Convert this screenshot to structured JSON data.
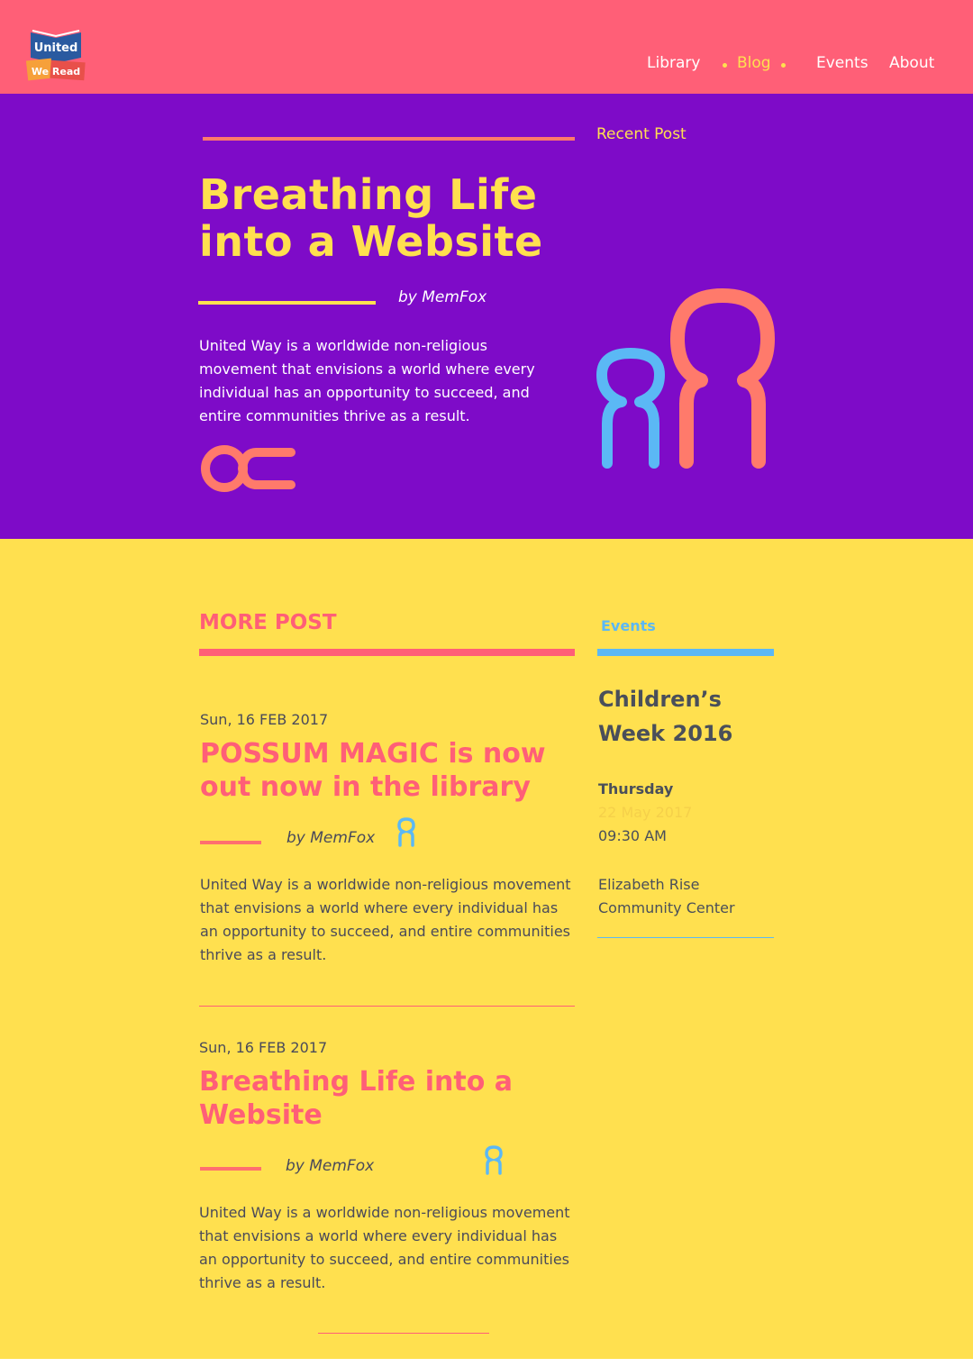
{
  "brand": {
    "logo_line1": "United",
    "logo_line2": "We Read"
  },
  "nav": {
    "items": [
      {
        "label": "Library"
      },
      {
        "label": "Blog"
      },
      {
        "label": "Events"
      },
      {
        "label": "About"
      }
    ],
    "active": "Blog"
  },
  "hero": {
    "title": "Breathing Life into a Website",
    "byline": "by MemFox",
    "text": "United Way is a worldwide non-religious movement that envisions a world where every individual has an opportunity to succeed, and entire communities thrive as a result.",
    "recent_label": "Recent Post"
  },
  "more": {
    "heading": "MORE POST",
    "posts": [
      {
        "date": "Sun, 16 FEB 2017",
        "title": "POSSUM MAGIC is now out now in the library",
        "byline": "by MemFox",
        "text": "United Way is a worldwide non-religious movement that envisions a world where every individual has an opportunity to succeed, and entire communities thrive as a result."
      },
      {
        "date": "Sun, 16 FEB 2017",
        "title": "Breathing Life into a Website",
        "byline": "by MemFox",
        "text": "United Way is a worldwide non-religious movement that envisions a world where every individual has an opportunity to succeed, and entire communities thrive as a result."
      }
    ]
  },
  "events": {
    "heading": "Events",
    "title": "Children’s Week 2016",
    "day": "Thursday",
    "date": "22 May 2017",
    "time": "09:30 AM",
    "venue": "Elizabeth Rise Community Center"
  },
  "colors": {
    "header": "#ff5f77",
    "hero": "#7e0bc8",
    "yellow": "#ffe04f",
    "blue": "#5bb8f5",
    "coral": "#ff7a6b"
  }
}
